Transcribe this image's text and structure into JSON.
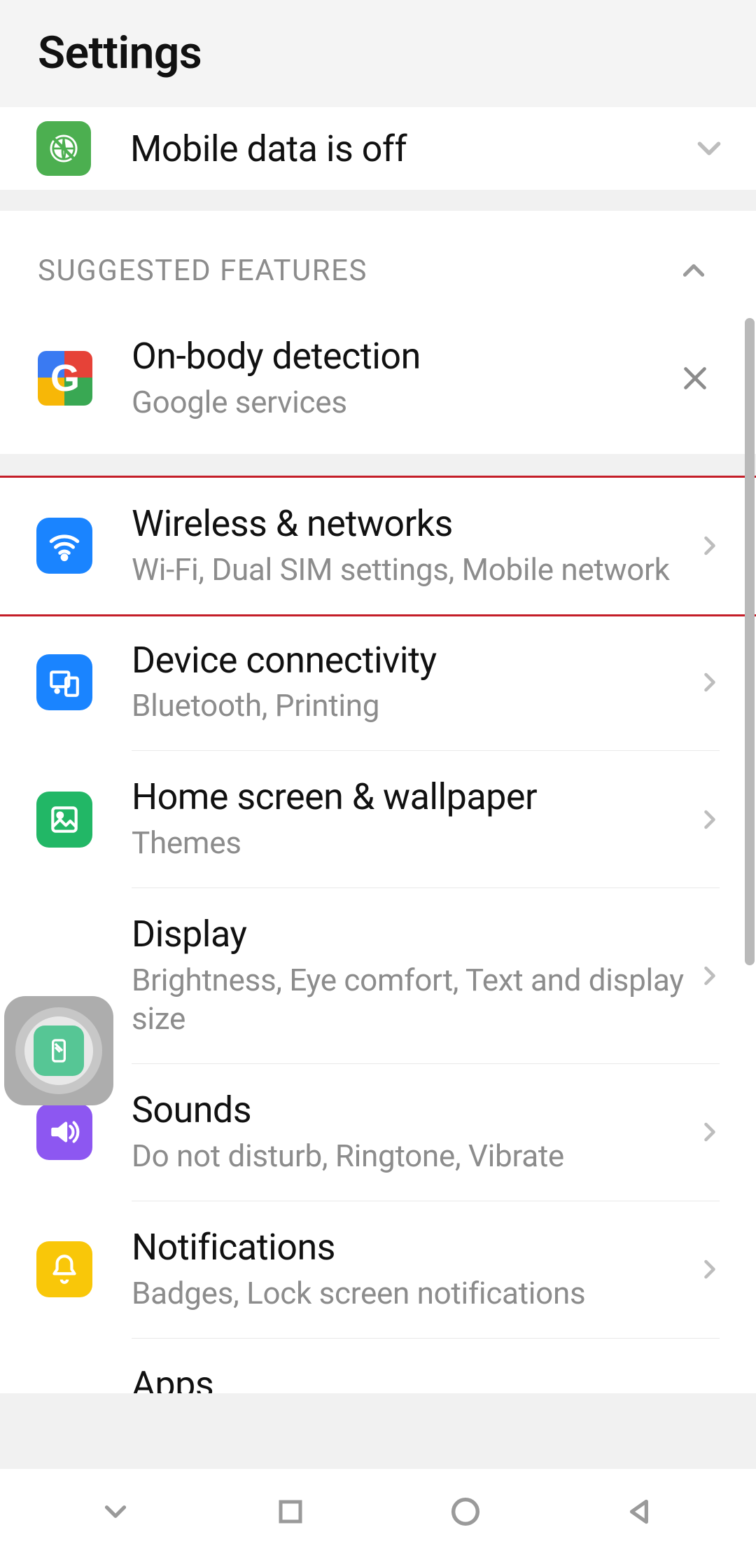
{
  "header": {
    "title": "Settings"
  },
  "status": {
    "label": "Mobile data is off"
  },
  "suggested": {
    "section_label": "SUGGESTED FEATURES",
    "title": "On-body detection",
    "subtitle": "Google services"
  },
  "rows": {
    "wireless": {
      "title": "Wireless & networks",
      "subtitle": "Wi-Fi, Dual SIM settings, Mobile network"
    },
    "connectivity": {
      "title": "Device connectivity",
      "subtitle": "Bluetooth, Printing"
    },
    "homescreen": {
      "title": "Home screen & wallpaper",
      "subtitle": "Themes"
    },
    "display": {
      "title": "Display",
      "subtitle": "Brightness, Eye comfort, Text and display size"
    },
    "sounds": {
      "title": "Sounds",
      "subtitle": "Do not disturb, Ringtone, Vibrate"
    },
    "notifications": {
      "title": "Notifications",
      "subtitle": "Badges, Lock screen notifications"
    },
    "apps": {
      "title": "Apps"
    }
  }
}
